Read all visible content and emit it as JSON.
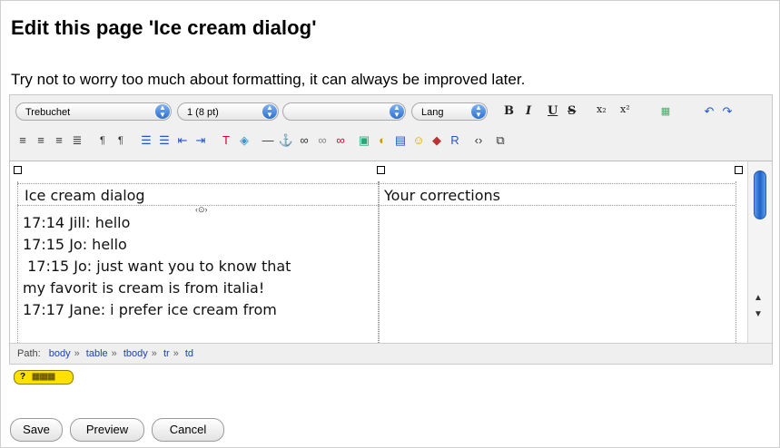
{
  "page": {
    "title": "Edit this page 'Ice cream dialog'",
    "hint": "Try not to worry too much about formatting, it can always be improved later."
  },
  "toolbar": {
    "font_family": "Trebuchet",
    "font_size": "1 (8 pt)",
    "format": "",
    "lang": "Lang",
    "bold": "B",
    "italic": "I",
    "underline": "U",
    "strike": "S",
    "subscript": "x₂",
    "superscript": "x²"
  },
  "table": {
    "headers": [
      "Ice cream dialog",
      "Your corrections"
    ],
    "lines": [
      "17:14 Jill: hello",
      "17:15 Jo: hello",
      " 17:15 Jo: just want you to know that",
      "my favorit is cream is from italia!",
      "17:17 Jane: i prefer ice cream from"
    ]
  },
  "path": {
    "label": "Path:",
    "items": [
      "body",
      "table",
      "tbody",
      "tr",
      "td"
    ],
    "separator": "»"
  },
  "help": {
    "text": "?"
  },
  "buttons": {
    "save": "Save",
    "preview": "Preview",
    "cancel": "Cancel"
  }
}
